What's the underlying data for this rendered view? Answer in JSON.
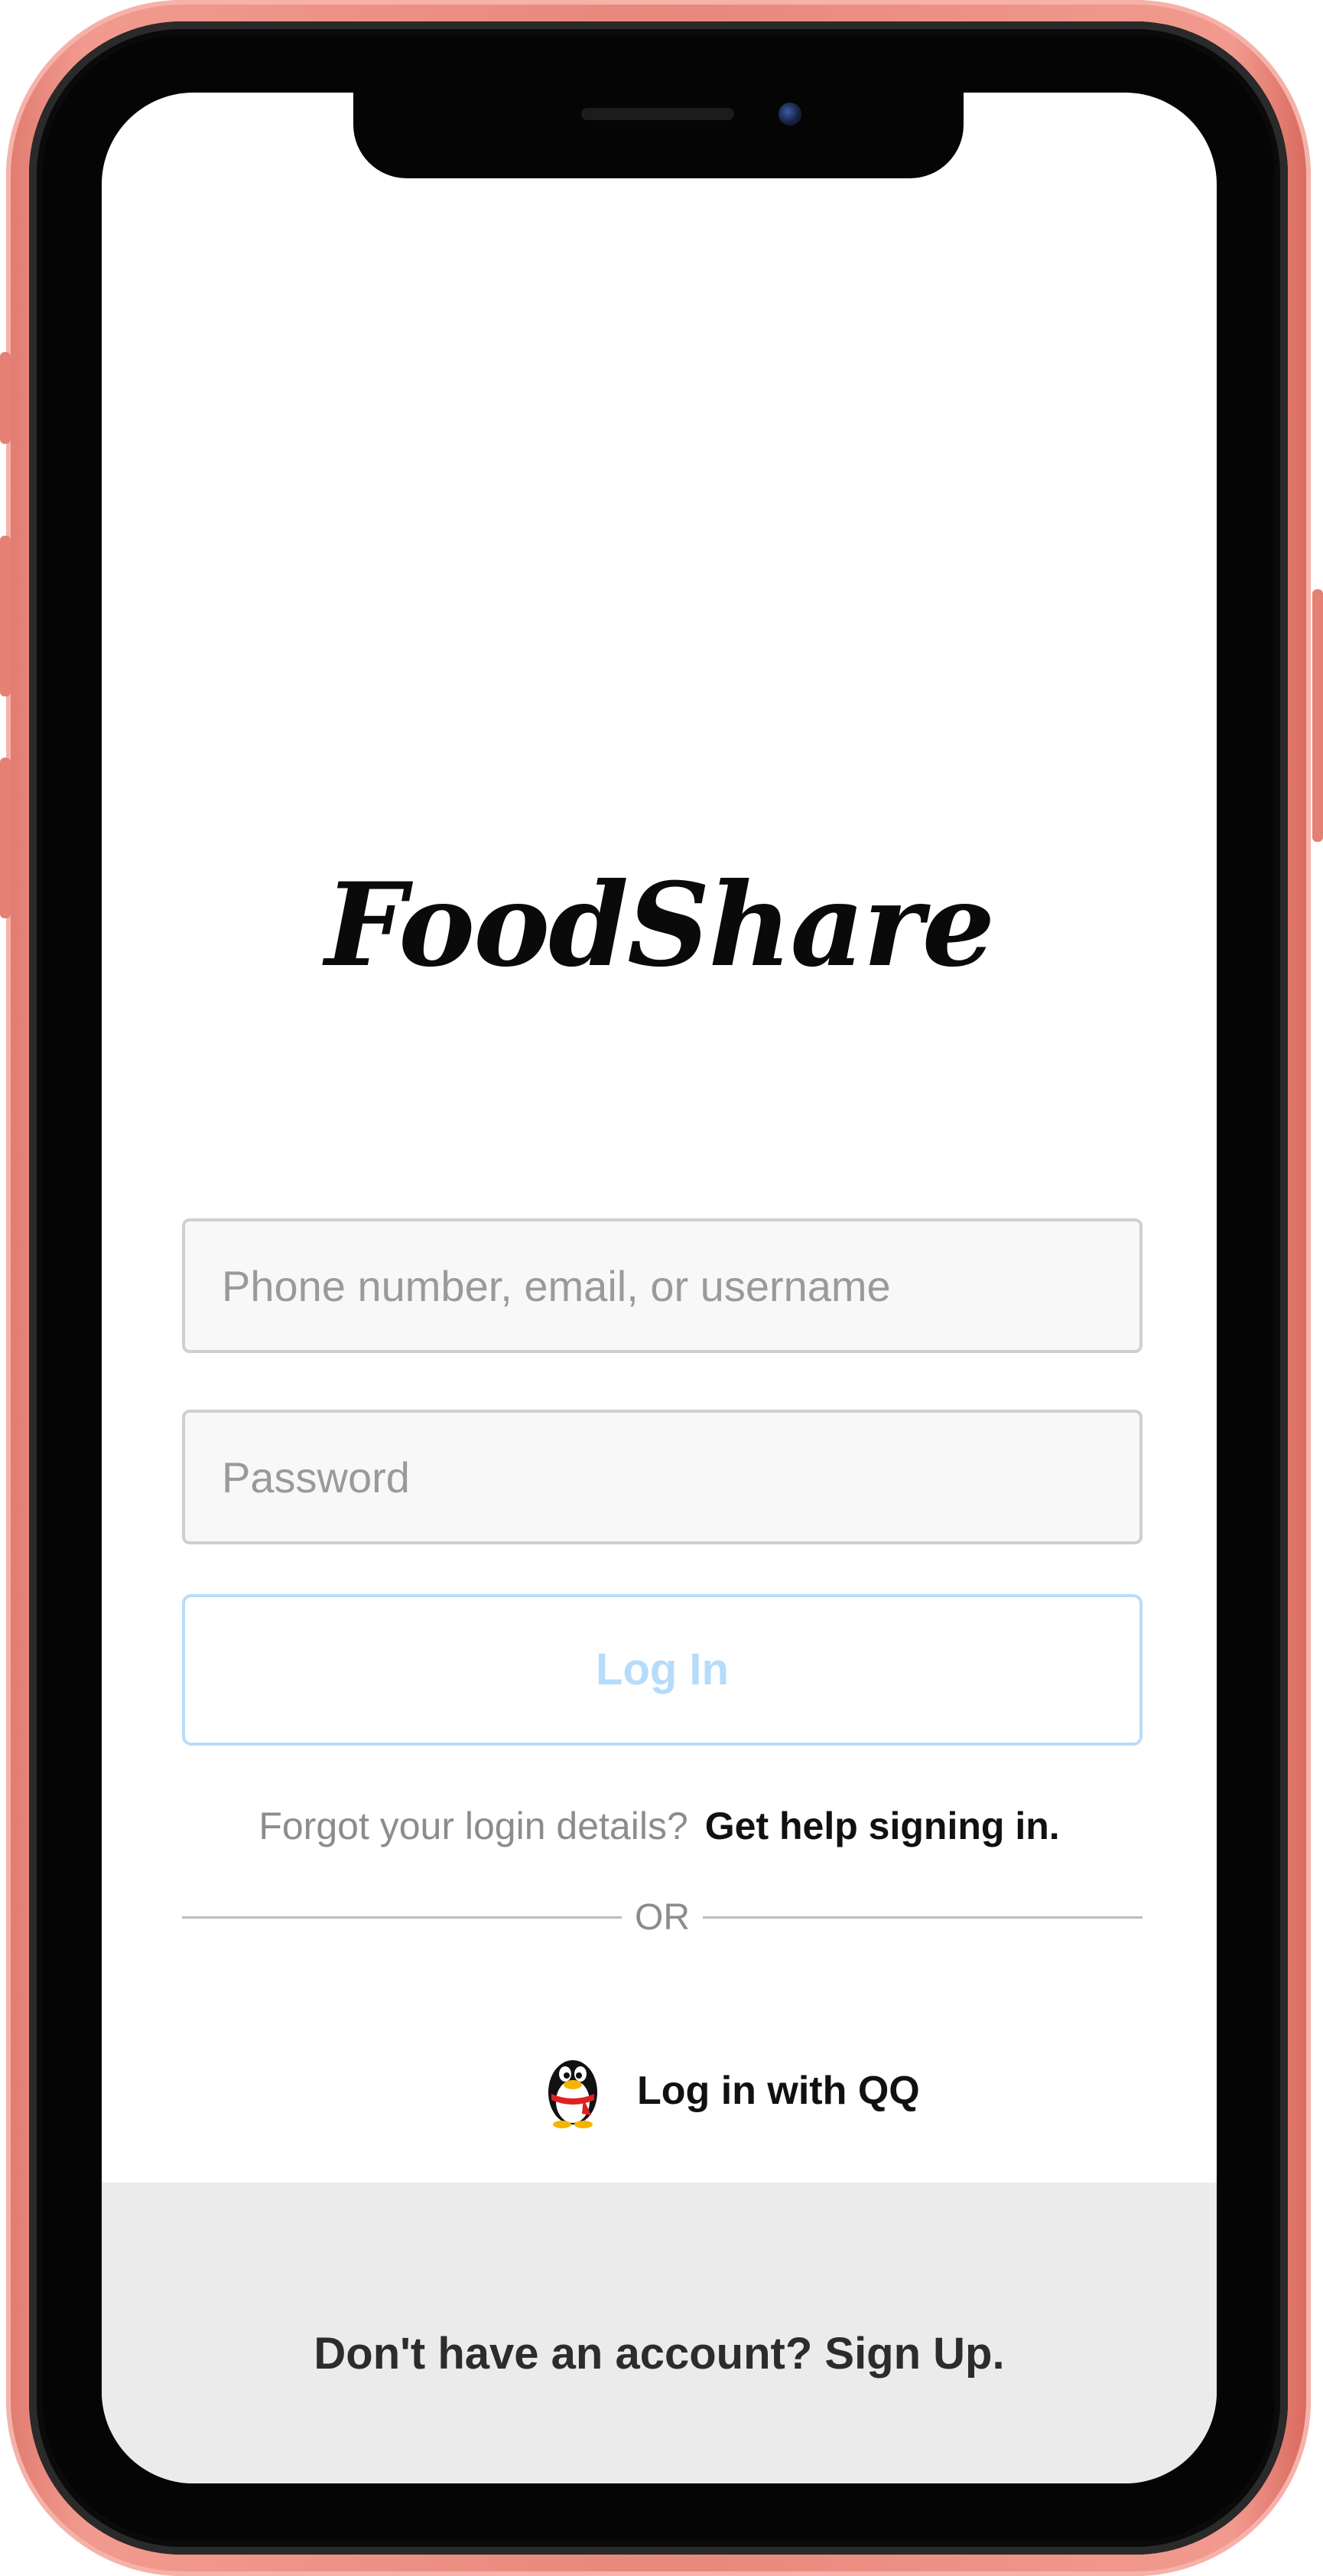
{
  "app": {
    "logo_text": "FoodShare"
  },
  "login_form": {
    "username_placeholder": "Phone number, email, or username",
    "password_placeholder": "Password",
    "login_button_label": "Log In"
  },
  "help": {
    "prompt": "Forgot your login details?",
    "link": "Get help signing in."
  },
  "divider": {
    "label": "OR"
  },
  "social_login": {
    "label": "Log in with QQ",
    "icon": "qq-penguin-icon"
  },
  "footer": {
    "signup_text": "Don't have an account? Sign Up."
  },
  "colors": {
    "phone_frame": "#e8877c",
    "login_button_text": "#b6dcfb",
    "login_button_border": "#b9dcf8",
    "footer_background": "#ebebeb",
    "field_background": "#f8f8f8"
  }
}
